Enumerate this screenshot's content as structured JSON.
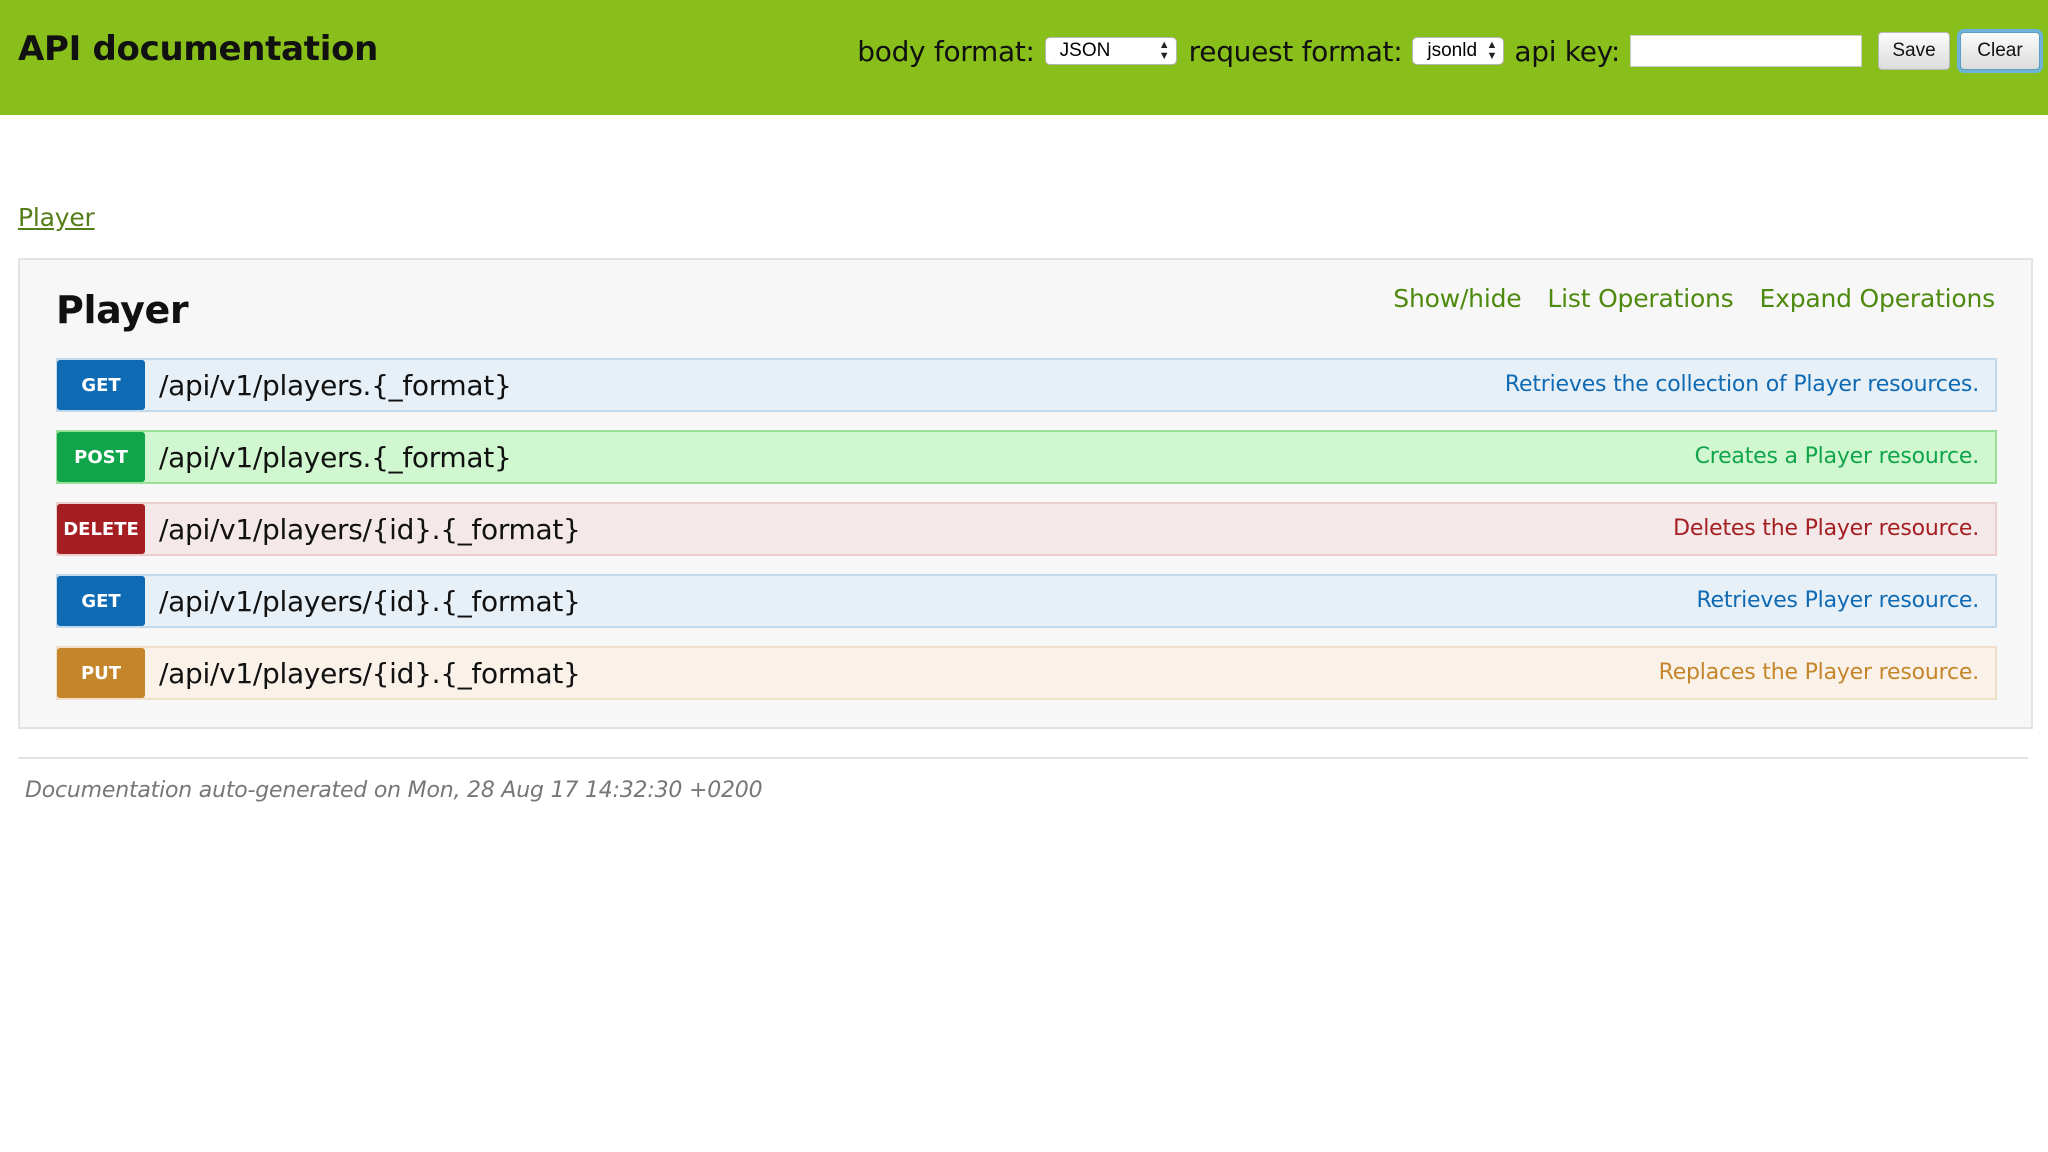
{
  "header": {
    "title": "API documentation",
    "body_format_label": "body format:",
    "body_format_value": "JSON",
    "request_format_label": "request format:",
    "request_format_value": "jsonld",
    "api_key_label": "api key:",
    "api_key_value": "",
    "save_label": "Save",
    "clear_label": "Clear"
  },
  "breadcrumb": {
    "label": "Player"
  },
  "resource": {
    "title": "Player",
    "links": {
      "show_hide": "Show/hide",
      "list_operations": "List Operations",
      "expand_operations": "Expand Operations"
    },
    "operations": [
      {
        "method": "GET",
        "path": "/api/v1/players.{_format}",
        "summary": "Retrieves the collection of Player resources."
      },
      {
        "method": "POST",
        "path": "/api/v1/players.{_format}",
        "summary": "Creates a Player resource."
      },
      {
        "method": "DELETE",
        "path": "/api/v1/players/{id}.{_format}",
        "summary": "Deletes the Player resource."
      },
      {
        "method": "GET",
        "path": "/api/v1/players/{id}.{_format}",
        "summary": "Retrieves Player resource."
      },
      {
        "method": "PUT",
        "path": "/api/v1/players/{id}.{_format}",
        "summary": "Replaces the Player resource."
      }
    ]
  },
  "footer": {
    "text": "Documentation auto-generated on Mon, 28 Aug 17 14:32:30 +0200"
  },
  "colors": {
    "header_bg": "#89bf1a",
    "get": "#0f6ab4",
    "post": "#10a54a",
    "delete": "#a41e22",
    "put": "#c5862b",
    "link": "#4e8a0f"
  }
}
